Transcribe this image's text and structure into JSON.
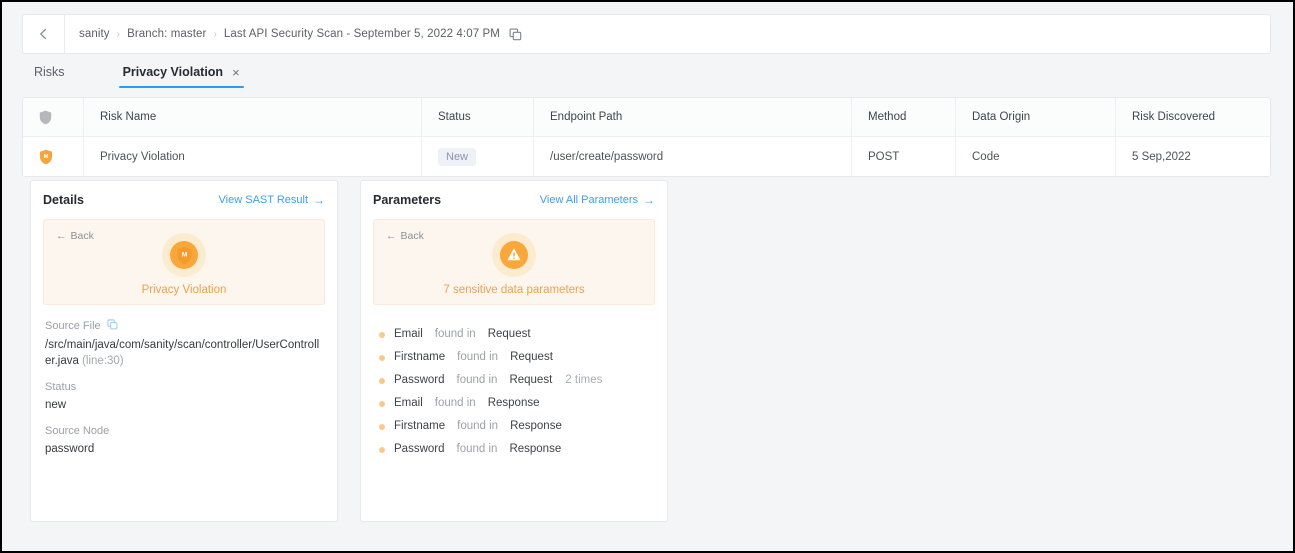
{
  "breadcrumb": {
    "back_icon": "arrow-left-icon",
    "items": [
      {
        "label": "sanity"
      },
      {
        "label": "Branch: master"
      },
      {
        "label": "Last API Security Scan - September 5, 2022 4:07 PM"
      }
    ],
    "separator": "›",
    "copy_icon": "copy-icon"
  },
  "tabs": [
    {
      "label": "Risks",
      "active": false,
      "closable": false
    },
    {
      "label": "Privacy Violation",
      "active": true,
      "closable": true,
      "close_label": "×"
    }
  ],
  "table": {
    "header_icon": "shield-icon",
    "columns": [
      "",
      "Risk Name",
      "Status",
      "Endpoint Path",
      "Method",
      "Data Origin",
      "Risk Discovered"
    ],
    "rows": [
      {
        "icon": "shield-medium-icon",
        "icon_letter": "M",
        "risk_name": "Privacy Violation",
        "status": "New",
        "endpoint_path": "/user/create/password",
        "method": "POST",
        "data_origin": "Code",
        "risk_discovered": "5 Sep,2022"
      }
    ]
  },
  "details_card": {
    "title": "Details",
    "link": "View SAST Result",
    "link_arrow": "→",
    "banner": {
      "back": "Back",
      "back_arrow": "←",
      "icon": "shield-medium-icon",
      "icon_letter": "M",
      "label": "Privacy Violation"
    },
    "fields": [
      {
        "label": "Source File",
        "has_copy": true,
        "value": "/src/main/java/com/sanity/scan/controller/UserController.java",
        "suffix": "(line:30)"
      },
      {
        "label": "Status",
        "has_copy": false,
        "value": "new",
        "suffix": ""
      },
      {
        "label": "Source Node",
        "has_copy": false,
        "value": "password",
        "suffix": ""
      }
    ]
  },
  "parameters_card": {
    "title": "Parameters",
    "link": "View All Parameters",
    "link_arrow": "→",
    "banner": {
      "back": "Back",
      "back_arrow": "←",
      "icon": "warning-triangle-icon",
      "label": "7 sensitive data parameters"
    },
    "items": [
      {
        "name": "Email",
        "mid": "found in",
        "location": "Request",
        "times": ""
      },
      {
        "name": "Firstname",
        "mid": "found in",
        "location": "Request",
        "times": ""
      },
      {
        "name": "Password",
        "mid": "found in",
        "location": "Request",
        "times": "2 times"
      },
      {
        "name": "Email",
        "mid": "found in",
        "location": "Response",
        "times": ""
      },
      {
        "name": "Firstname",
        "mid": "found in",
        "location": "Response",
        "times": ""
      },
      {
        "name": "Password",
        "mid": "found in",
        "location": "Response",
        "times": ""
      }
    ]
  },
  "colors": {
    "accent_blue": "#3ba0ef",
    "tab_underline": "#2d9cf0",
    "orange": "#f9a63a",
    "orange_text": "#f0a04b",
    "banner_bg": "#fdf6ee",
    "page_bg": "#f4f5f6"
  }
}
